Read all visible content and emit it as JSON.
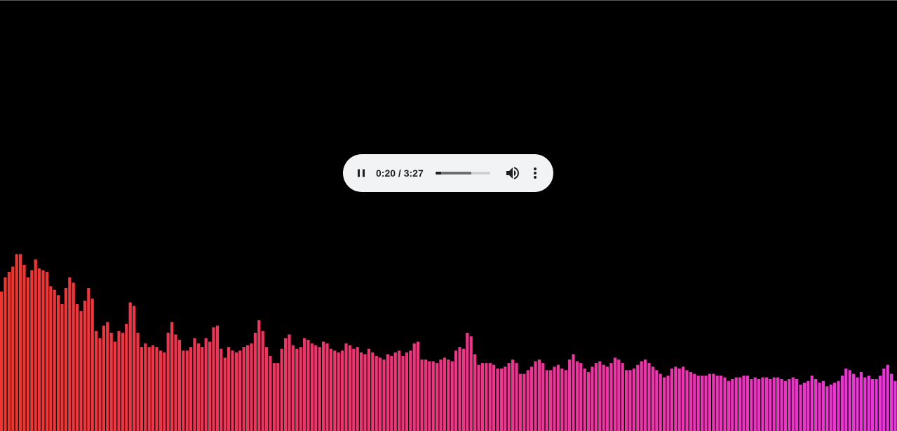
{
  "player": {
    "current_time": "0:20",
    "separator": " / ",
    "duration": "3:27",
    "played_fraction": 0.097,
    "buffered_fraction": 0.65,
    "state": "playing",
    "icons": {
      "pause": "pause-icon",
      "volume": "volume-icon",
      "more": "more-vert-icon"
    }
  },
  "visualizer": {
    "gradient_start": "#f2352a",
    "gradient_end": "#ee33e0",
    "levels": [
      0.78,
      0.86,
      0.89,
      0.92,
      0.99,
      0.99,
      0.93,
      0.86,
      0.9,
      0.96,
      0.91,
      0.9,
      0.89,
      0.81,
      0.79,
      0.76,
      0.71,
      0.8,
      0.86,
      0.83,
      0.71,
      0.67,
      0.73,
      0.8,
      0.74,
      0.56,
      0.52,
      0.59,
      0.61,
      0.55,
      0.5,
      0.56,
      0.55,
      0.6,
      0.72,
      0.7,
      0.55,
      0.47,
      0.49,
      0.47,
      0.48,
      0.47,
      0.45,
      0.44,
      0.55,
      0.61,
      0.54,
      0.51,
      0.45,
      0.45,
      0.47,
      0.52,
      0.49,
      0.47,
      0.52,
      0.5,
      0.58,
      0.59,
      0.46,
      0.41,
      0.47,
      0.45,
      0.44,
      0.45,
      0.47,
      0.48,
      0.49,
      0.55,
      0.62,
      0.56,
      0.47,
      0.42,
      0.38,
      0.38,
      0.46,
      0.52,
      0.54,
      0.48,
      0.46,
      0.47,
      0.52,
      0.51,
      0.49,
      0.48,
      0.47,
      0.5,
      0.49,
      0.46,
      0.45,
      0.44,
      0.45,
      0.49,
      0.48,
      0.46,
      0.47,
      0.44,
      0.43,
      0.46,
      0.44,
      0.42,
      0.41,
      0.4,
      0.43,
      0.42,
      0.44,
      0.45,
      0.42,
      0.44,
      0.45,
      0.49,
      0.5,
      0.4,
      0.4,
      0.39,
      0.39,
      0.38,
      0.4,
      0.41,
      0.4,
      0.39,
      0.45,
      0.47,
      0.46,
      0.55,
      0.53,
      0.43,
      0.37,
      0.38,
      0.38,
      0.38,
      0.37,
      0.35,
      0.35,
      0.36,
      0.38,
      0.4,
      0.38,
      0.32,
      0.32,
      0.34,
      0.36,
      0.39,
      0.4,
      0.38,
      0.34,
      0.34,
      0.36,
      0.37,
      0.35,
      0.34,
      0.4,
      0.43,
      0.39,
      0.38,
      0.35,
      0.33,
      0.36,
      0.38,
      0.39,
      0.37,
      0.36,
      0.38,
      0.41,
      0.4,
      0.38,
      0.34,
      0.34,
      0.35,
      0.37,
      0.39,
      0.4,
      0.38,
      0.36,
      0.34,
      0.32,
      0.3,
      0.31,
      0.35,
      0.36,
      0.35,
      0.36,
      0.34,
      0.33,
      0.32,
      0.31,
      0.31,
      0.31,
      0.32,
      0.32,
      0.31,
      0.31,
      0.3,
      0.28,
      0.29,
      0.3,
      0.3,
      0.31,
      0.31,
      0.29,
      0.3,
      0.29,
      0.3,
      0.3,
      0.29,
      0.3,
      0.3,
      0.29,
      0.28,
      0.29,
      0.3,
      0.29,
      0.26,
      0.27,
      0.28,
      0.31,
      0.29,
      0.27,
      0.28,
      0.25,
      0.26,
      0.27,
      0.28,
      0.31,
      0.35,
      0.34,
      0.32,
      0.3,
      0.33,
      0.3,
      0.31,
      0.29,
      0.29,
      0.31,
      0.35,
      0.37,
      0.32,
      0.28,
      0.32,
      0.34,
      0.33,
      0.3,
      0.27,
      0.26,
      0.31,
      0.32,
      0.29,
      0.27,
      0.26,
      0.27,
      0.26,
      0.25,
      0.24,
      0.26,
      0.27,
      0.28,
      0.25,
      0.23,
      0.25,
      0.27,
      0.29,
      0.31,
      0.3,
      0.28,
      0.29,
      0.27,
      0.26,
      0.25,
      0.22,
      0.2,
      0.18,
      0.17
    ]
  }
}
